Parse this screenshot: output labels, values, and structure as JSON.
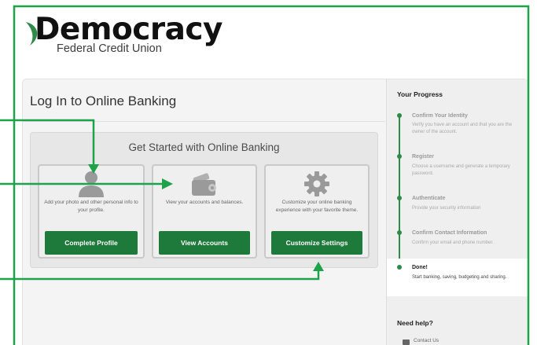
{
  "brand": {
    "name": "Democracy",
    "subtitle": "Federal Credit Union",
    "leaf_color": "#2f8a48"
  },
  "main": {
    "title": "Log In to Online Banking",
    "get_started": {
      "title": "Get Started with Online Banking",
      "cards": [
        {
          "icon": "user-silhouette-icon",
          "description": "Add your photo and other personal info to your profile.",
          "button": "Complete Profile"
        },
        {
          "icon": "wallet-icon",
          "description": "View your accounts and balances.",
          "button": "View Accounts"
        },
        {
          "icon": "gear-icon",
          "description": "Customize your online banking experience with your favorite theme.",
          "button": "Customize Settings"
        }
      ]
    }
  },
  "progress": {
    "heading": "Your Progress",
    "steps": [
      {
        "title": "Confirm Your Identity",
        "description": "Verify you have an account and that you are the owner of the account."
      },
      {
        "title": "Register",
        "description": "Choose a username and generate a temporary password."
      },
      {
        "title": "Authenticate",
        "description": "Provide your security information"
      },
      {
        "title": "Confirm Contact Information",
        "description": "Confirm your email and phone number."
      },
      {
        "title": "Done!",
        "description": "Start banking, saving, budgeting and sharing."
      }
    ],
    "help_heading": "Need help?",
    "contact_label": "Contact Us"
  },
  "colors": {
    "accent": "#1e7a3a",
    "annotation": "#1ea34a"
  }
}
